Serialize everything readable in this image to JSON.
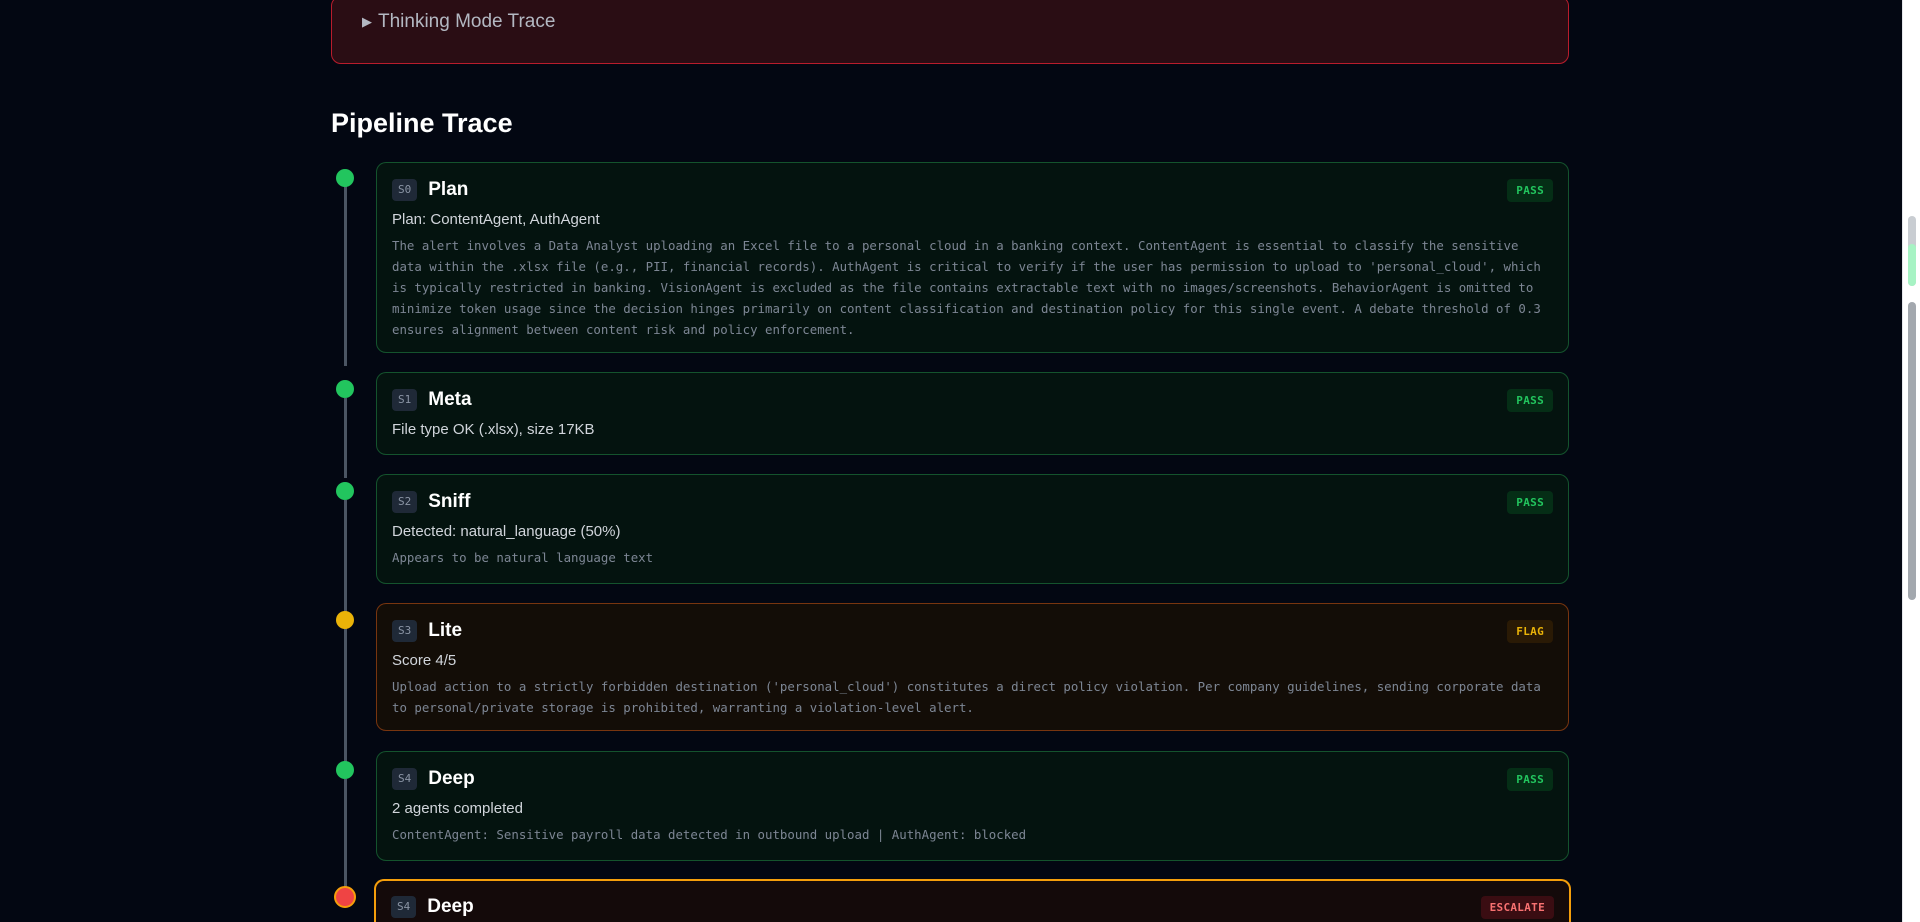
{
  "thinking": {
    "label": "Thinking Mode Trace",
    "icon": "triangle-right-icon"
  },
  "pipeline": {
    "title": "Pipeline Trace",
    "steps": [
      {
        "tag": "S0",
        "name": "Plan",
        "status": "PASS",
        "summary": "Plan: ContentAgent, AuthAgent",
        "detail": "The alert involves a Data Analyst uploading an Excel file to a personal cloud in a banking context. ContentAgent is essential to classify the sensitive data within the .xlsx file (e.g., PII, financial records). AuthAgent is critical to verify if the user has permission to upload to 'personal_cloud', which is typically restricted in banking. VisionAgent is excluded as the file contains extractable text with no images/screenshots. BehaviorAgent is omitted to minimize token usage since the decision hinges primarily on content classification and destination policy for this single event. A debate threshold of 0.3 ensures alignment between content risk and policy enforcement."
      },
      {
        "tag": "S1",
        "name": "Meta",
        "status": "PASS",
        "summary": "File type OK (.xlsx), size 17KB",
        "detail": ""
      },
      {
        "tag": "S2",
        "name": "Sniff",
        "status": "PASS",
        "summary": "Detected: natural_language (50%)",
        "detail": "Appears to be natural language text"
      },
      {
        "tag": "S3",
        "name": "Lite",
        "status": "FLAG",
        "summary": "Score 4/5",
        "detail": "Upload action to a strictly forbidden destination ('personal_cloud') constitutes a direct policy violation. Per company guidelines, sending corporate data to personal/private storage is prohibited, warranting a violation-level alert."
      },
      {
        "tag": "S4",
        "name": "Deep",
        "status": "PASS",
        "summary": "2 agents completed",
        "detail": "ContentAgent: Sensitive payroll data detected in outbound upload | AuthAgent: blocked"
      },
      {
        "tag": "S4",
        "name": "Deep",
        "status": "ESCALATE",
        "summary": "",
        "detail": ""
      }
    ]
  },
  "colors": {
    "pass": "#22c55e",
    "flag": "#eab308",
    "escalate": "#ef4444",
    "background": "#030712"
  }
}
